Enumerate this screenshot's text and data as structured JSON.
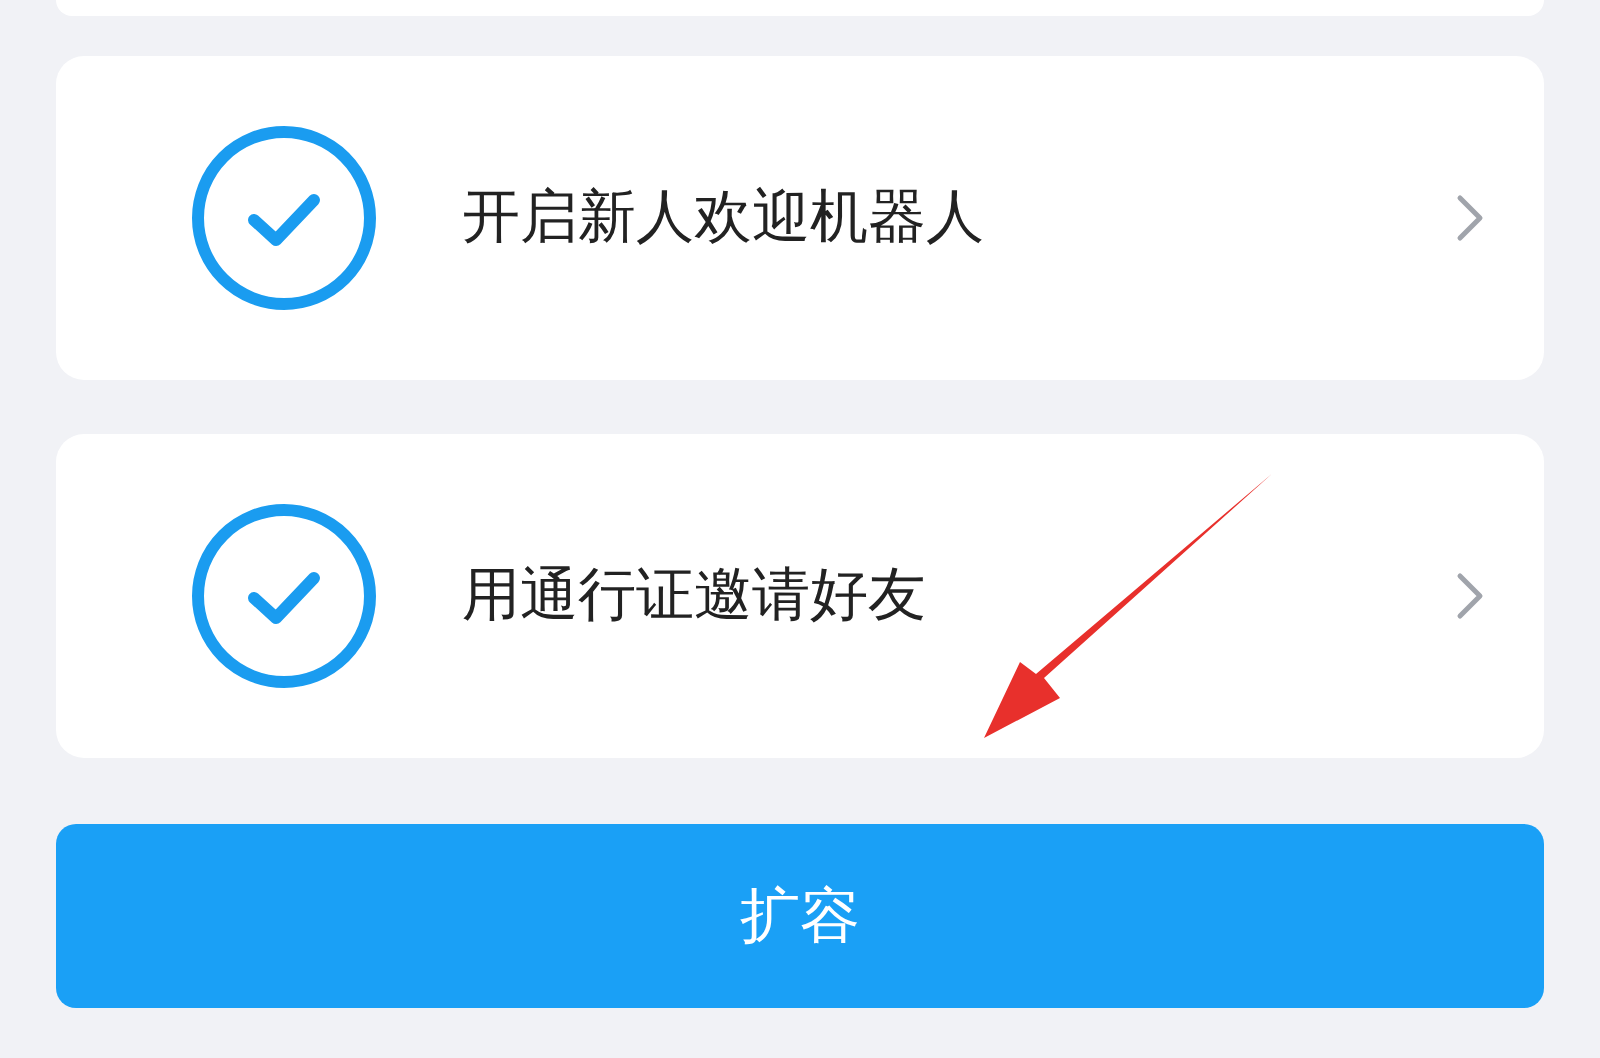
{
  "tasks": [
    {
      "title": "开启新人欢迎机器人",
      "done": true
    },
    {
      "title": "用通行证邀请好友",
      "done": true
    }
  ],
  "button": {
    "label": "扩容"
  }
}
